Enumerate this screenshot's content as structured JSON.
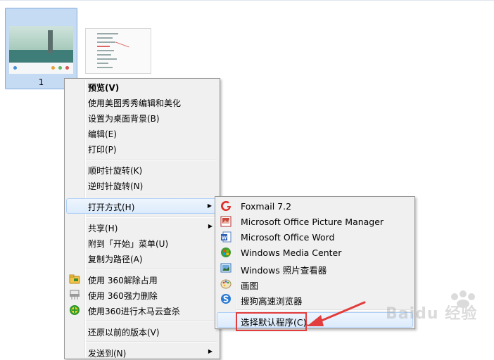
{
  "thumbnails": [
    {
      "label": "1",
      "selected": true
    },
    {
      "label": "",
      "selected": false
    }
  ],
  "context_menu": {
    "items": [
      {
        "label": "预览(V)",
        "bold": true
      },
      {
        "label": "使用美图秀秀编辑和美化"
      },
      {
        "label": "设置为桌面背景(B)"
      },
      {
        "label": "编辑(E)"
      },
      {
        "label": "打印(P)"
      },
      {
        "label": "顺时针旋转(K)"
      },
      {
        "label": "逆时针旋转(N)"
      },
      {
        "label": "打开方式(H)",
        "submenu": true,
        "highlighted": true
      },
      {
        "label": "共享(H)",
        "submenu": true
      },
      {
        "label": "附到「开始」菜单(U)"
      },
      {
        "label": "复制为路径(A)"
      },
      {
        "label": "使用 360解除占用",
        "icon": "360-unlock-icon"
      },
      {
        "label": "使用 360强力删除",
        "icon": "360-shred-icon"
      },
      {
        "label": "使用360进行木马云查杀",
        "icon": "360-trojan-scan-icon"
      },
      {
        "label": "还原以前的版本(V)"
      },
      {
        "label": "发送到(N)",
        "submenu": true
      }
    ]
  },
  "open_with_menu": {
    "items": [
      {
        "label": "Foxmail 7.2",
        "icon": "foxmail-icon"
      },
      {
        "label": "Microsoft Office Picture Manager",
        "icon": "picture-manager-icon"
      },
      {
        "label": "Microsoft Office Word",
        "icon": "word-icon"
      },
      {
        "label": "Windows Media Center",
        "icon": "media-center-icon"
      },
      {
        "label": "Windows 照片查看器",
        "icon": "photo-viewer-icon"
      },
      {
        "label": "画图",
        "icon": "paint-icon"
      },
      {
        "label": "搜狗高速浏览器",
        "icon": "sogou-browser-icon"
      },
      {
        "label": "选择默认程序(C)...",
        "highlighted": true
      }
    ]
  },
  "annotation": {
    "color": "#e23c3c"
  },
  "watermark": {
    "text": "Baidu 经验"
  }
}
